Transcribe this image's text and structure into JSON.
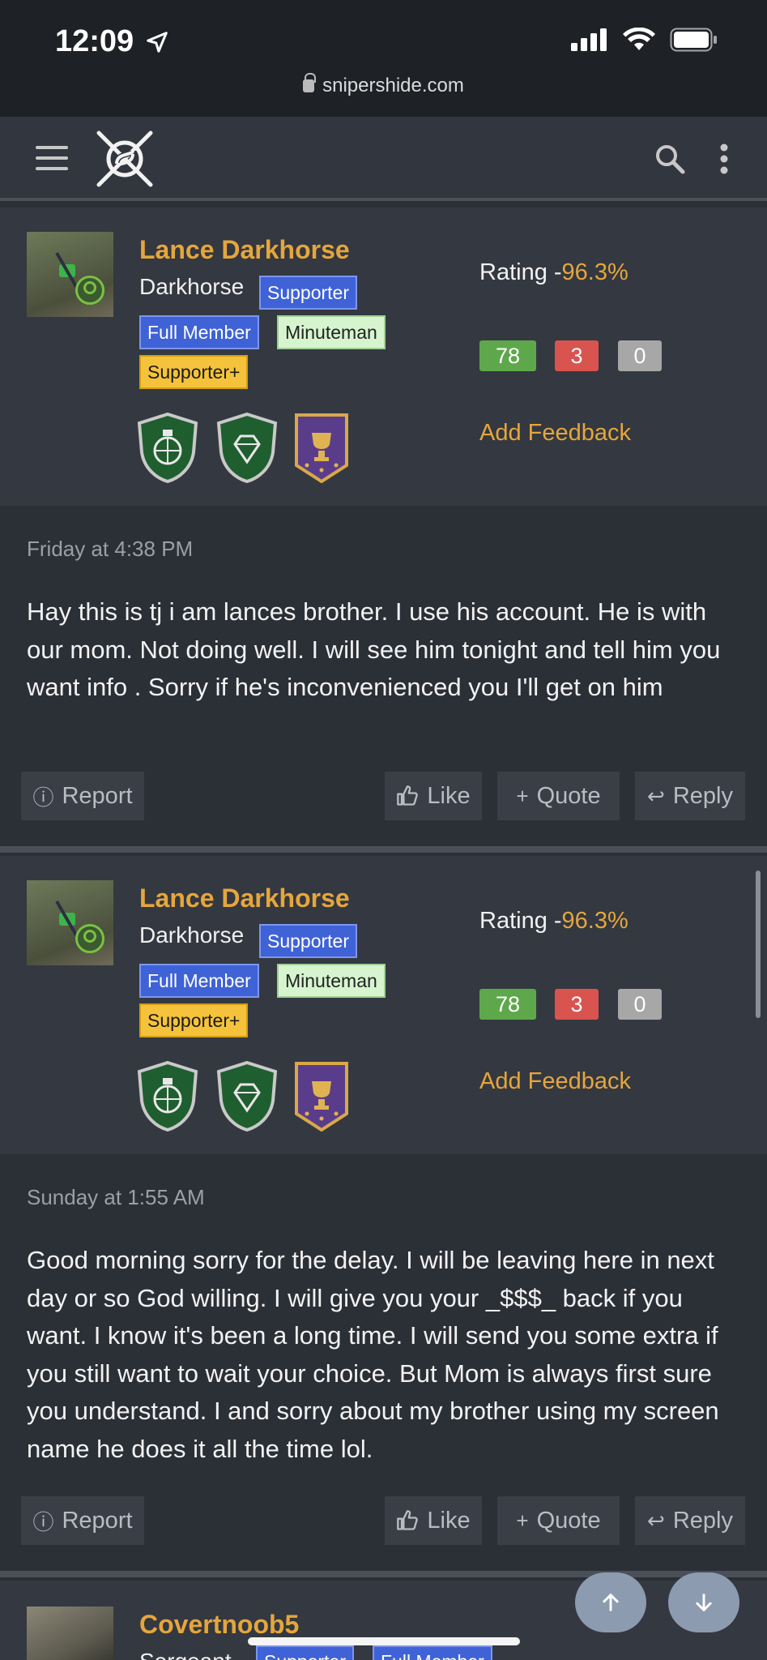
{
  "status_bar": {
    "time": "12:09",
    "url": "snipershide.com"
  },
  "nav": {
    "menu": "menu",
    "site": "Sniper's Hide"
  },
  "posts": [
    {
      "author": "Lance Darkhorse",
      "title": "Darkhorse",
      "badges": [
        "Supporter",
        "Full Member",
        "Minuteman",
        "Supporter+"
      ],
      "rating_label": "Rating -",
      "rating_value": "96.3%",
      "feedback": {
        "positive": "78",
        "negative": "3",
        "neutral": "0"
      },
      "add_feedback": "Add Feedback",
      "date": "Friday at 4:38 PM",
      "body": "Hay this is tj i am lances brother. I use his account. He is with our mom. Not doing well. I will see him tonight and tell him you want info . Sorry if he's inconvenienced you I'll get on him",
      "actions": {
        "report": "Report",
        "like": "Like",
        "quote": "Quote",
        "reply": "Reply"
      }
    },
    {
      "author": "Lance Darkhorse",
      "title": "Darkhorse",
      "badges": [
        "Supporter",
        "Full Member",
        "Minuteman",
        "Supporter+"
      ],
      "rating_label": "Rating -",
      "rating_value": "96.3%",
      "feedback": {
        "positive": "78",
        "negative": "3",
        "neutral": "0"
      },
      "add_feedback": "Add Feedback",
      "date": "Sunday at 1:55 AM",
      "body": "Good morning sorry for the delay. I will be leaving here in next day or so God willing. I will give you your _$$$_ back if you want. I know it's been a long time. I will send you some extra if you still want to wait your choice. But Mom is always first sure you understand. I and sorry about my brother using my screen name he does it all the time lol.",
      "actions": {
        "report": "Report",
        "like": "Like",
        "quote": "Quote",
        "reply": "Reply"
      }
    }
  ],
  "next_post": {
    "author": "Covertnoob5",
    "title": "Sergeant",
    "badges": [
      "Supporter",
      "Full Member"
    ]
  },
  "colors": {
    "accent": "#e5a63c",
    "background": "#2b2f36",
    "header": "#343840",
    "positive": "#5ea84b",
    "negative": "#d9534f",
    "neutral": "#a7a7a7"
  }
}
